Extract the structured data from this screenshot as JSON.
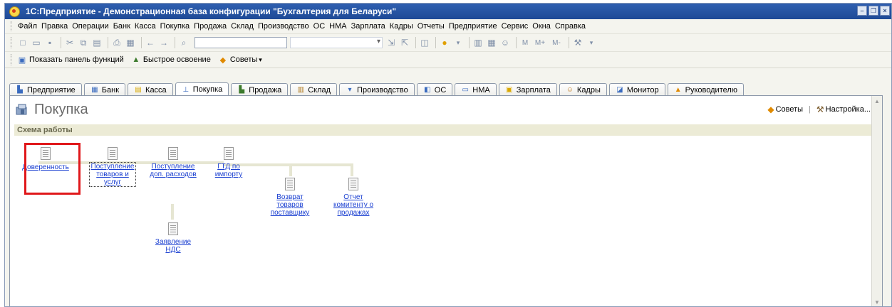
{
  "window": {
    "title": "1С:Предприятие - Демонстрационная база конфигурации \"Бухгалтерия для Беларуси\""
  },
  "menu": [
    "Файл",
    "Правка",
    "Операции",
    "Банк",
    "Касса",
    "Покупка",
    "Продажа",
    "Склад",
    "Производство",
    "ОС",
    "НМА",
    "Зарплата",
    "Кадры",
    "Отчеты",
    "Предприятие",
    "Сервис",
    "Окна",
    "Справка"
  ],
  "toolbar": {
    "mem_buttons": [
      "M",
      "M+",
      "M-"
    ]
  },
  "funcbar": {
    "show_panel": "Показать панель функций",
    "quick_learn": "Быстрое освоение",
    "tips": "Советы"
  },
  "tabs": [
    {
      "label": "Предприятие",
      "icon": "enterprise-icon"
    },
    {
      "label": "Банк",
      "icon": "bank-icon"
    },
    {
      "label": "Касса",
      "icon": "cash-icon"
    },
    {
      "label": "Покупка",
      "icon": "purchase-icon",
      "active": true
    },
    {
      "label": "Продажа",
      "icon": "sale-icon"
    },
    {
      "label": "Склад",
      "icon": "warehouse-icon"
    },
    {
      "label": "Производство",
      "icon": "production-icon"
    },
    {
      "label": "ОС",
      "icon": "fixed-assets-icon"
    },
    {
      "label": "НМА",
      "icon": "intangibles-icon"
    },
    {
      "label": "Зарплата",
      "icon": "salary-icon"
    },
    {
      "label": "Кадры",
      "icon": "hr-icon"
    },
    {
      "label": "Монитор",
      "icon": "monitor-icon"
    },
    {
      "label": "Руководителю",
      "icon": "warning-icon"
    }
  ],
  "panel": {
    "title": "Покупка",
    "tips_link": "Советы",
    "settings_link": "Настройка...",
    "section": "Схема работы"
  },
  "scheme": {
    "nodes": [
      {
        "id": "poa",
        "label": "Доверенность"
      },
      {
        "id": "receipt",
        "label": "Поступление товаров и услуг"
      },
      {
        "id": "extra",
        "label": "Поступление доп. расходов"
      },
      {
        "id": "gtd",
        "label": "ГТД по импорту"
      },
      {
        "id": "return",
        "label": "Возврат товаров поставщику"
      },
      {
        "id": "report",
        "label": "Отчет комитенту о продажах"
      },
      {
        "id": "vat",
        "label": "Заявление НДС"
      }
    ]
  },
  "colors": {
    "highlight": "#e0181b",
    "link": "#1a3fd1",
    "section_bg": "#ecebd6"
  }
}
